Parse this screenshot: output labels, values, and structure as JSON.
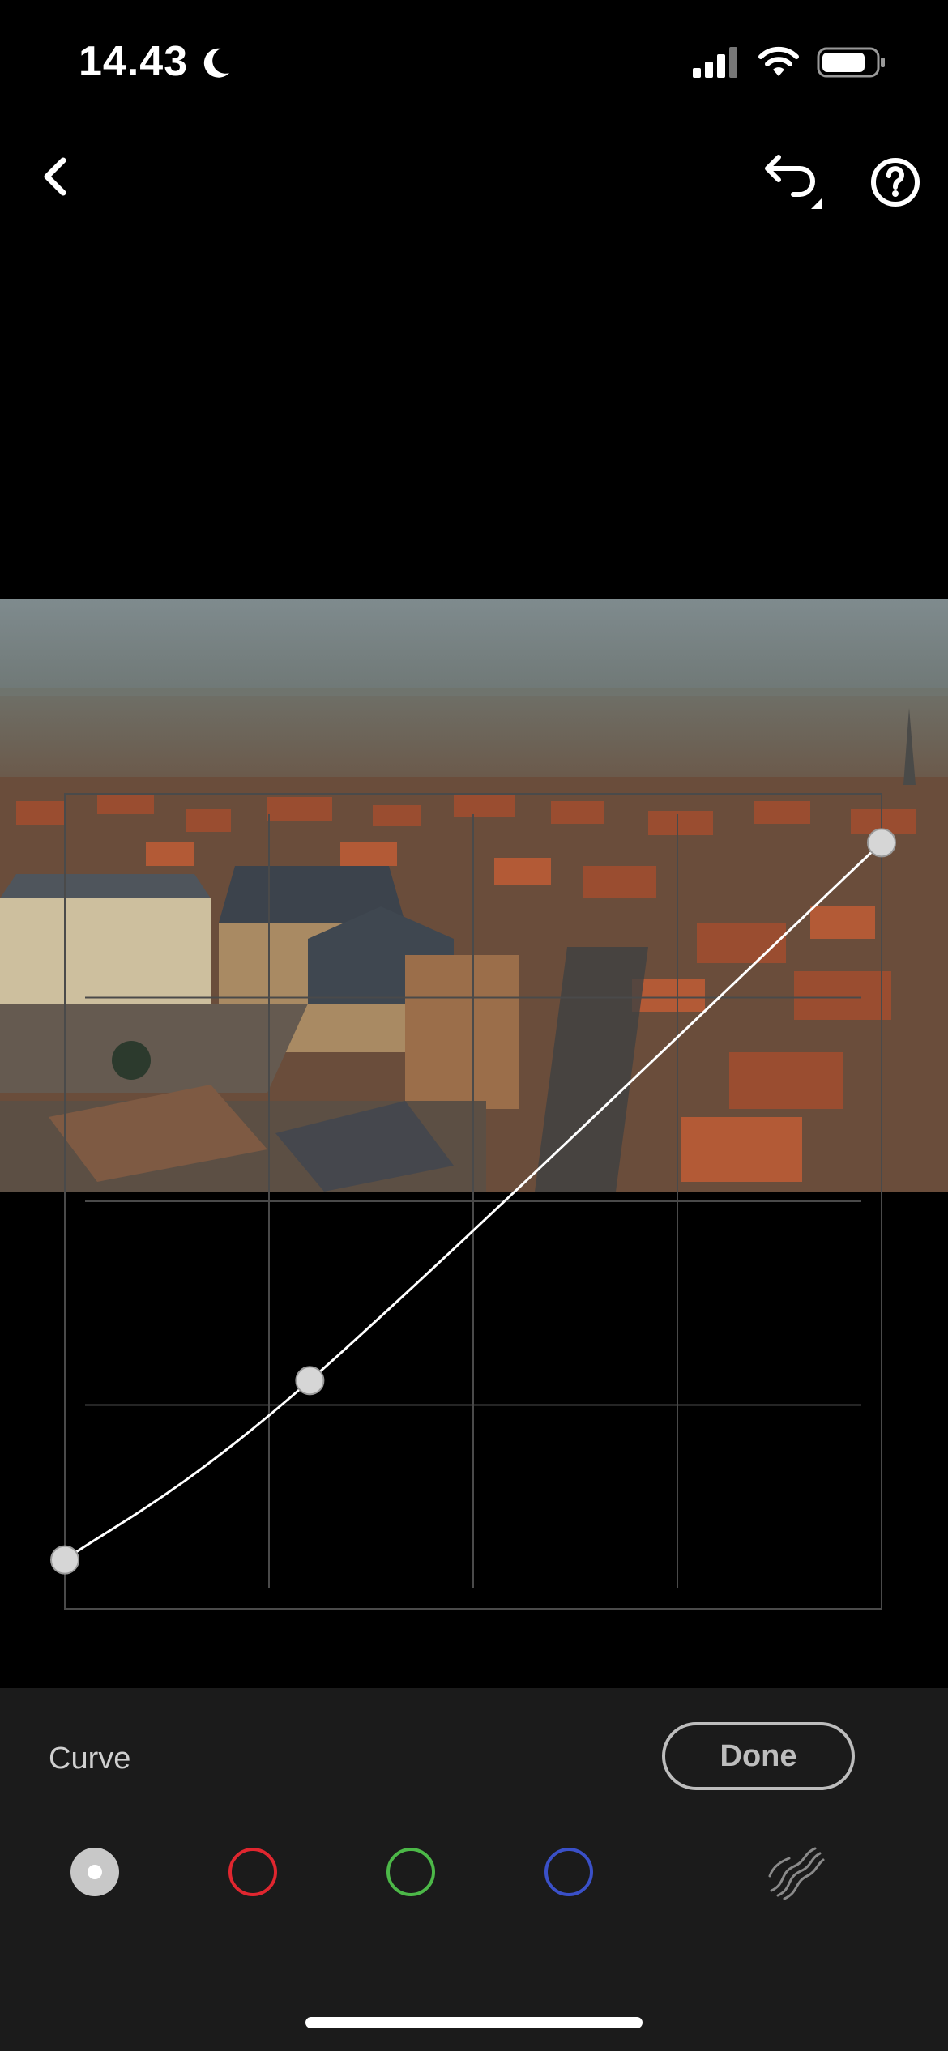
{
  "status_bar": {
    "time": "14.43",
    "icons": [
      "moon-icon",
      "cellular-signal-icon",
      "wifi-icon",
      "battery-icon"
    ]
  },
  "nav": {
    "icons": [
      "chevron-left-icon",
      "undo-icon",
      "help-icon"
    ]
  },
  "photo": {
    "description_icon": "aerial-city-photo"
  },
  "curve": {
    "channel": "RGB",
    "points": [
      [
        0,
        0.06
      ],
      [
        0.3,
        0.28
      ],
      [
        1,
        0.94
      ]
    ],
    "grid_divisions": 4
  },
  "panel": {
    "title": "Curve",
    "done_label": "Done",
    "channels": [
      {
        "name": "RGB",
        "icon": "rgb-channel-icon",
        "color": "#c8c8c8",
        "selected": true
      },
      {
        "name": "Red",
        "icon": "red-channel-icon",
        "color": "#e0262f",
        "selected": false
      },
      {
        "name": "Green",
        "icon": "green-channel-icon",
        "color": "#4cb848",
        "selected": false
      },
      {
        "name": "Blue",
        "icon": "blue-channel-icon",
        "color": "#3a50c8",
        "selected": false
      }
    ],
    "extra_icon": "targeted-adjustment-icon"
  },
  "colors": {
    "background": "#000000",
    "panel": "#1b1b1b",
    "grid": "#4a4a4a",
    "curve": "#ffffff"
  }
}
